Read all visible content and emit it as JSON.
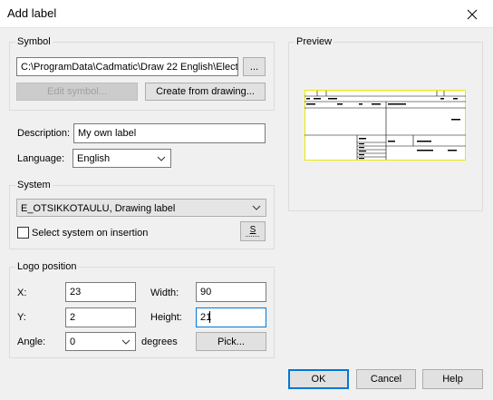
{
  "window": {
    "title": "Add label"
  },
  "symbol": {
    "group_label": "Symbol",
    "path_value": "C:\\ProgramData\\Cadmatic\\Draw 22 English\\Electrical",
    "browse_label": "...",
    "edit_label": "Edit symbol...",
    "create_label": "Create from drawing..."
  },
  "preview": {
    "group_label": "Preview"
  },
  "description": {
    "label": "Description:",
    "value": "My own label"
  },
  "language": {
    "label": "Language:",
    "value": "English"
  },
  "system": {
    "group_label": "System",
    "value": "E_OTSIKKOTAULU, Drawing label",
    "checkbox_label": "Select system on insertion",
    "pick_button_label": "S"
  },
  "logo": {
    "group_label": "Logo position",
    "x_label": "X:",
    "x_value": "23",
    "y_label": "Y:",
    "y_value": "2",
    "angle_label": "Angle:",
    "angle_value": "0",
    "width_label": "Width:",
    "width_value": "90",
    "height_label": "Height:",
    "height_value": "21",
    "degrees_label": "degrees",
    "pick_label": "Pick..."
  },
  "footer": {
    "ok_label": "OK",
    "cancel_label": "Cancel",
    "help_label": "Help"
  },
  "colors": {
    "accent": "#0078d7",
    "preview_border": "#e8e800"
  }
}
